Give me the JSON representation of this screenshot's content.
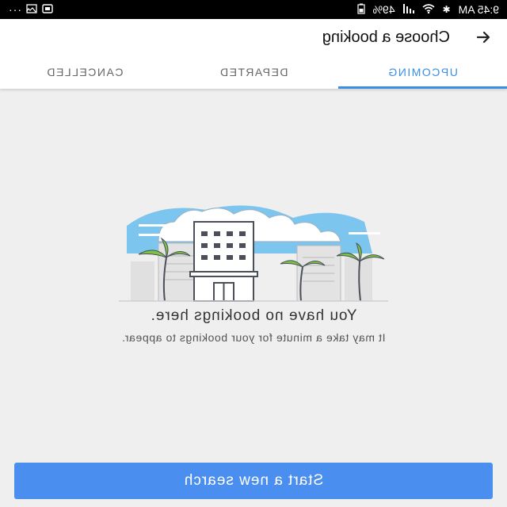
{
  "status_bar": {
    "time": "9:45 AM",
    "battery": "49%",
    "icons": [
      "signal-icon",
      "wifi-icon",
      "bluetooth-icon",
      "notification-icon",
      "overflow-dots-icon"
    ]
  },
  "app_bar": {
    "title": "Choose a booking",
    "back_icon": "arrow-back-icon"
  },
  "tabs": [
    {
      "label": "UPCOMING",
      "active": true
    },
    {
      "label": "DEPARTED",
      "active": false
    },
    {
      "label": "CANCELLED",
      "active": false
    }
  ],
  "empty_state": {
    "illustration": "hotel-with-palm-trees-illustration",
    "heading": "You have no bookings here.",
    "subtext": "It may take a minute for your bookings to appear."
  },
  "primary_button": {
    "label": "Start a new search"
  },
  "colors": {
    "accent": "#3a8ee6",
    "button": "#4a8ef0",
    "sky": "#7cc5ee",
    "palm": "#7dc243",
    "background": "#efefef"
  }
}
